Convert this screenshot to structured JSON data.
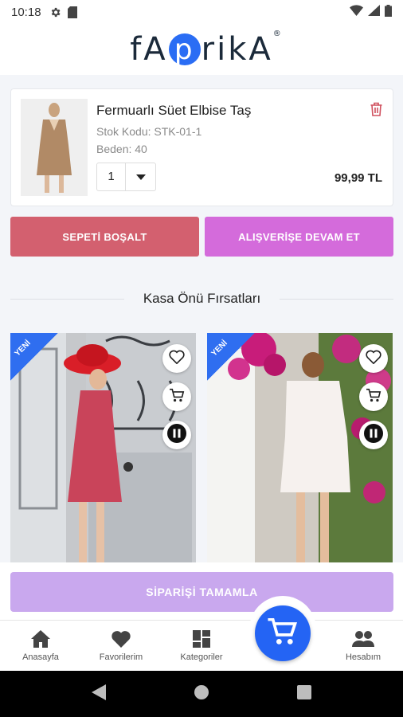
{
  "status_bar": {
    "time": "10:18",
    "icons": [
      "settings-icon",
      "sim-card-icon",
      "wifi-icon",
      "signal-icon",
      "battery-icon"
    ]
  },
  "brand": {
    "logo_text_pre": "fA",
    "logo_text_p": "p",
    "logo_text_post": "rikA",
    "logo_reg": "®",
    "accent": "#2a6df4"
  },
  "cart": {
    "item": {
      "title": "Fermuarlı Süet Elbise Taş",
      "stock_code": "Stok Kodu: STK-01-1",
      "size": "Beden: 40",
      "quantity": "1",
      "price": "99,99 TL"
    },
    "empty_button": "SEPETİ BOŞALT",
    "continue_button": "ALIŞVERİŞE DEVAM ET"
  },
  "deals": {
    "title": "Kasa Önü Fırsatları",
    "products": [
      {
        "badge": "YENİ",
        "icons": [
          "heart-icon",
          "cart-icon",
          "pause-icon"
        ]
      },
      {
        "badge": "YENİ",
        "icons": [
          "heart-icon",
          "cart-icon",
          "pause-icon"
        ]
      }
    ]
  },
  "checkout_button": "SİPARİŞİ TAMAMLA",
  "bottom_nav": {
    "items": [
      {
        "label": "Anasayfa",
        "icon": "home-icon"
      },
      {
        "label": "Favorilerim",
        "icon": "heart-icon"
      },
      {
        "label": "Kategoriler",
        "icon": "grid-icon"
      },
      {
        "label": "",
        "icon": "cart-icon"
      },
      {
        "label": "Hesabım",
        "icon": "people-icon"
      }
    ]
  },
  "colors": {
    "empty_btn": "#d3606f",
    "continue_btn": "#d46bdb",
    "checkout_btn": "#c9a8ee",
    "fab": "#2464f4",
    "badge": "#2f6ef0"
  }
}
